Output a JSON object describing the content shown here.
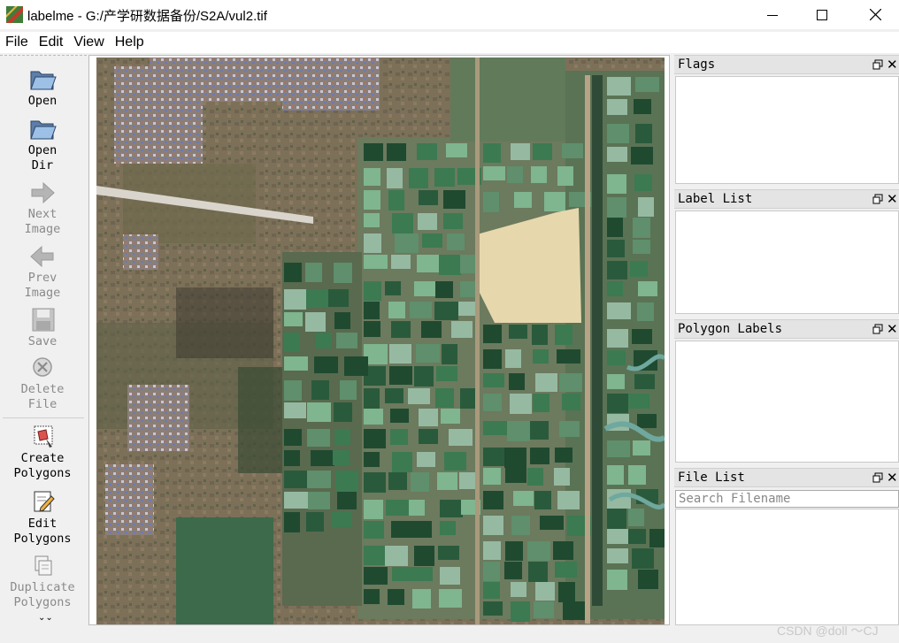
{
  "window": {
    "title": "labelme - G:/产学研数据备份/S2A/vul2.tif",
    "minimize_icon": "minimize-icon",
    "maximize_icon": "maximize-icon",
    "close_icon": "close-icon"
  },
  "menu": [
    "File",
    "Edit",
    "View",
    "Help"
  ],
  "toolbar": {
    "open": "Open",
    "open_dir_1": "Open",
    "open_dir_2": "Dir",
    "next_1": "Next",
    "next_2": "Image",
    "prev_1": "Prev",
    "prev_2": "Image",
    "save": "Save",
    "delete_1": "Delete",
    "delete_2": "File",
    "create_1": "Create",
    "create_2": "Polygons",
    "edit_1": "Edit",
    "edit_2": "Polygons",
    "dup_1": "Duplicate",
    "dup_2": "Polygons"
  },
  "docks": {
    "flags": "Flags",
    "label_list": "Label List",
    "polygon_labels": "Polygon Labels",
    "file_list": "File List",
    "search_placeholder": "Search Filename"
  },
  "watermark": "CSDN @doll ～CJ",
  "colors": {
    "terrain": "#7a6d55",
    "pond_dark": "#1f4a30",
    "pond_mid": "#3c7a52",
    "pond_light": "#7fb58f",
    "sand": "#e6d7ad",
    "road": "#c9b69a"
  }
}
